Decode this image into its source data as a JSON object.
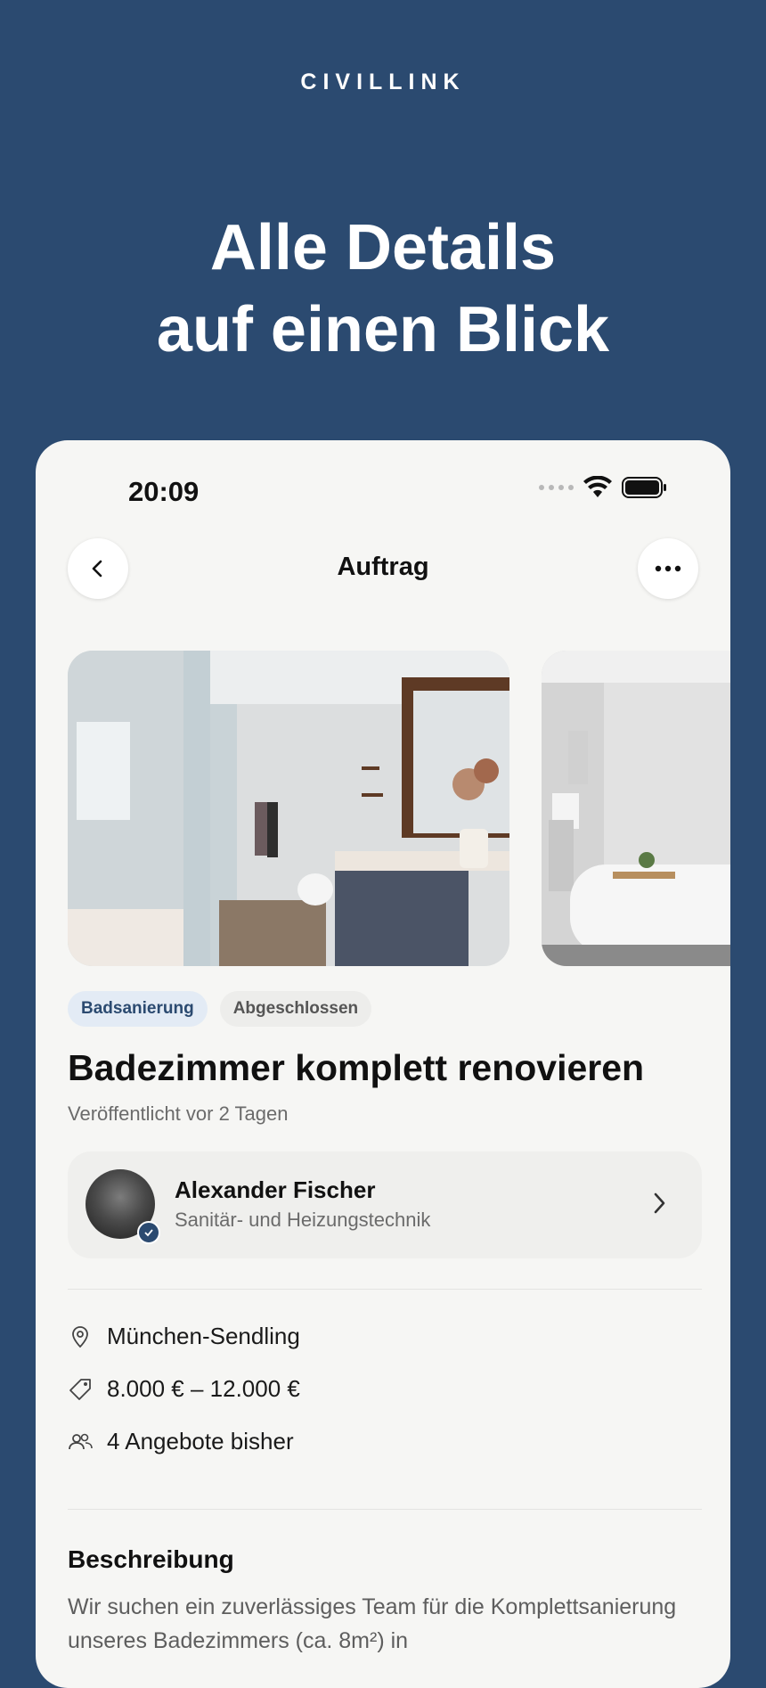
{
  "brand": "CIVILLINK",
  "headline": {
    "line1": "Alle Details",
    "line2": "auf einen Blick"
  },
  "status_bar": {
    "time": "20:09"
  },
  "nav": {
    "title": "Auftrag",
    "back_icon": "chevron-left-icon",
    "more_icon": "ellipsis-icon"
  },
  "tags": [
    {
      "label": "Badsanierung",
      "bg": "#e3ebf5",
      "color": "#2b4a70"
    },
    {
      "label": "Abgeschlossen",
      "bg": "#ededeb",
      "color": "#555555"
    }
  ],
  "job": {
    "title": "Badezimmer komplett renovieren",
    "published": "Veröffentlicht vor 2 Tagen"
  },
  "contractor": {
    "name": "Alexander Fischer",
    "trade": "Sanitär- und Heizungstechnik"
  },
  "details": {
    "location": "München-Sendling",
    "budget": "8.000 € – 12.000 €",
    "offers": "4 Angebote bisher"
  },
  "description": {
    "title": "Beschreibung",
    "text": "Wir suchen ein zuverlässiges Team für die Komplettsanierung unseres Badezimmers (ca. 8m²) in"
  },
  "colors": {
    "background": "#2b4a70",
    "card": "#f6f6f4"
  }
}
